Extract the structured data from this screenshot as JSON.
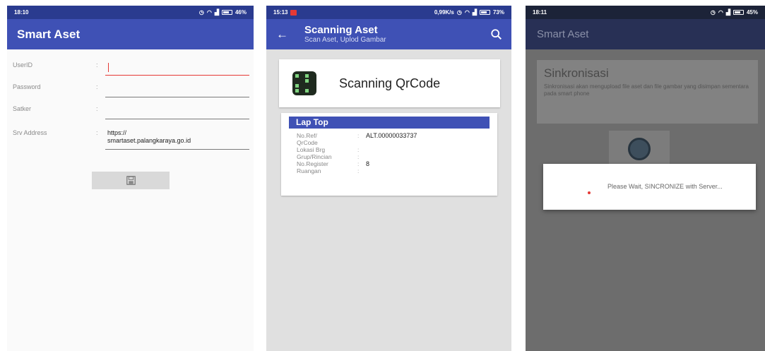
{
  "screen1": {
    "status": {
      "time": "18:10",
      "battery": "46%"
    },
    "title": "Smart Aset",
    "fields": [
      {
        "label": "UserID",
        "value": ""
      },
      {
        "label": "Password",
        "value": ""
      },
      {
        "label": "Satker",
        "value": ""
      }
    ],
    "srv": {
      "label": "Srv Address",
      "value_line1": "https://",
      "value_line2": "smartaset.palangkaraya.go.id"
    },
    "colon": ":",
    "save_icon": "save-icon"
  },
  "screen2": {
    "status": {
      "time": "15:13",
      "speed": "0,99K/s",
      "battery": "73%"
    },
    "title": "Scanning Aset",
    "subtitle": "Scan Aset, Uplod Gambar",
    "scan_label": "Scanning QrCode",
    "detail": {
      "header": "Lap Top",
      "rows": [
        {
          "label": "No.Ref/",
          "value": "ALT.00000033737"
        },
        {
          "label": "QrCode",
          "value": ""
        },
        {
          "label": "Lokasi Brg",
          "value": ""
        },
        {
          "label": "Grup/Rincian",
          "value": ""
        },
        {
          "label": "No.Register",
          "value": "8"
        },
        {
          "label": "Ruangan",
          "value": ""
        }
      ]
    }
  },
  "screen3": {
    "status": {
      "time": "18:11",
      "battery": "45%"
    },
    "title": "Smart Aset",
    "sync_title": "Sinkronisasi",
    "sync_desc": "Sinkronisasi akan mengupload file aset dan file gambar yang disimpan sementara pada smart phone",
    "dialog_text": "Please Wait, SINCRONIZE with Server..."
  },
  "colors": {
    "primary": "#3f51b5",
    "statusbar": "#2a3b8f",
    "accent": "#e53935"
  }
}
